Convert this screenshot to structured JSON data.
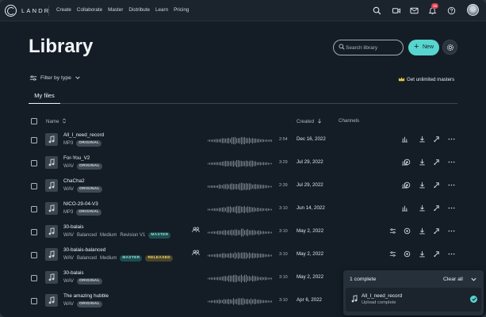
{
  "brand": "LANDR",
  "nav": [
    "Create",
    "Collaborate",
    "Master",
    "Distribute",
    "Learn",
    "Pricing"
  ],
  "notifications_count": "16",
  "page_title": "Library",
  "search": {
    "placeholder": "Search library"
  },
  "new_button": "New",
  "filter_label": "Filter by type",
  "unlimited_label": "Get unlimited masters",
  "tab_active": "My files",
  "columns": {
    "name": "Name",
    "created": "Created",
    "channels": "Channels"
  },
  "files": [
    {
      "name": "All_I_need_record",
      "format": "MP3",
      "details": [],
      "badges": [
        {
          "text": "ORIGINAL",
          "style": "gray"
        }
      ],
      "duration": "2:54",
      "date": "Dec 16, 2022",
      "collab": false,
      "actions": [
        "channels",
        "download",
        "share",
        "more"
      ]
    },
    {
      "name": "For-You_V2",
      "format": "WAV",
      "details": [],
      "badges": [
        {
          "text": "ORIGINAL",
          "style": "gray"
        }
      ],
      "duration": "3:29",
      "date": "Jul 29, 2022",
      "collab": false,
      "actions": [
        "channels",
        "master",
        "download",
        "share",
        "more"
      ]
    },
    {
      "name": "ChaCha2",
      "format": "WAV",
      "details": [],
      "badges": [
        {
          "text": "ORIGINAL",
          "style": "gray"
        }
      ],
      "duration": "2:39",
      "date": "Jul 29, 2022",
      "collab": false,
      "actions": [
        "channels",
        "master",
        "download",
        "share",
        "more"
      ]
    },
    {
      "name": "NICO-29-04-V3",
      "format": "MP3",
      "details": [],
      "badges": [
        {
          "text": "ORIGINAL",
          "style": "gray"
        }
      ],
      "duration": "3:10",
      "date": "Jun 14, 2022",
      "collab": false,
      "actions": [
        "channels",
        "download",
        "share",
        "more"
      ]
    },
    {
      "name": "30-balais",
      "format": "WAV",
      "details": [
        "Balanced",
        "Medium",
        "Revision V1"
      ],
      "badges": [
        {
          "text": "MASTER",
          "style": "teal"
        }
      ],
      "duration": "3:10",
      "date": "May 2, 2022",
      "collab": true,
      "actions": [
        "settings",
        "master",
        "download",
        "share",
        "more"
      ]
    },
    {
      "name": "30-balais-balanced",
      "format": "WAV",
      "details": [
        "Balanced",
        "Medium"
      ],
      "badges": [
        {
          "text": "MASTER",
          "style": "teal"
        },
        {
          "text": "RELEASED",
          "style": "yellow"
        }
      ],
      "duration": "3:10",
      "date": "May 2, 2022",
      "collab": true,
      "actions": [
        "settings",
        "master",
        "download",
        "share",
        "more"
      ]
    },
    {
      "name": "30-balais",
      "format": "WAV",
      "details": [],
      "badges": [
        {
          "text": "ORIGINAL",
          "style": "gray"
        }
      ],
      "duration": "3:10",
      "date": "May 2, 2022",
      "collab": false,
      "actions": []
    },
    {
      "name": "The amazing hubble",
      "format": "WAV",
      "details": [],
      "badges": [
        {
          "text": "ORIGINAL",
          "style": "gray"
        }
      ],
      "duration": "3:10",
      "date": "Apr 6, 2022",
      "collab": false,
      "actions": []
    }
  ],
  "toast": {
    "title": "1 complete",
    "clear_all": "Clear all",
    "item_name": "All_I_need_record",
    "item_status": "Upload complete"
  },
  "colors": {
    "accent": "#58d5cf",
    "background": "#141d26",
    "topbar": "#1b242d"
  }
}
